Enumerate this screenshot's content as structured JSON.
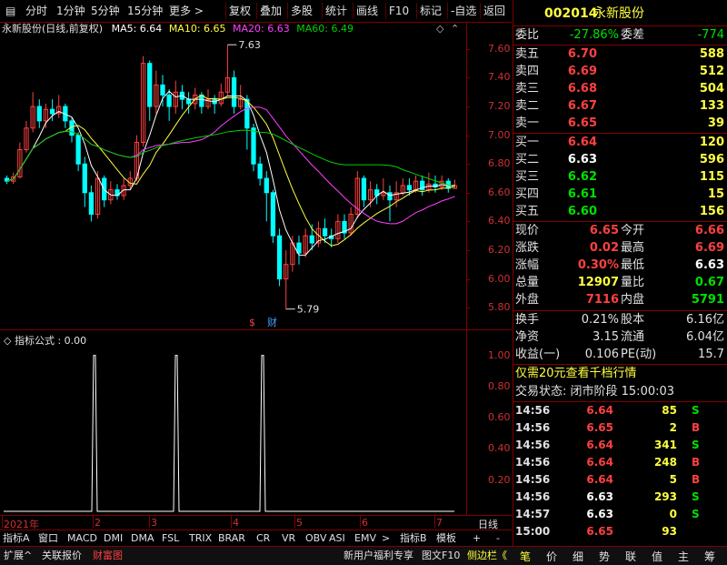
{
  "colors": {
    "up": "#ff4040",
    "down": "#00e000",
    "flat": "#ffffff",
    "ma5": "#ffffff",
    "ma10": "#ffff40",
    "ma20": "#ff40ff",
    "ma60": "#00d000",
    "grid": "#800000",
    "axis": "#d03030"
  },
  "toolbar": {
    "left": [
      "分时",
      "1分钟",
      "5分钟",
      "15分钟",
      "更多 >"
    ],
    "right": [
      "复权",
      "叠加",
      "多股",
      "统计",
      "画线",
      "F10",
      "标记",
      "-自选",
      "返回"
    ]
  },
  "chart": {
    "stock_name": "永新股份(日线,前复权)",
    "ma5_label": "MA5: 6.64",
    "ma10_label": "MA10: 6.65",
    "ma20_label": "MA20: 6.63",
    "ma60_label": "MA60: 6.49",
    "y_ticks": [
      "7.60",
      "7.40",
      "7.20",
      "7.00",
      "6.80",
      "6.60",
      "6.40",
      "6.20",
      "6.00",
      "5.80"
    ],
    "high_mark": "7.63",
    "low_mark": "5.79",
    "event_marks": [
      "$",
      "财"
    ]
  },
  "indicator": {
    "title": "指标公式 : 0.00",
    "y_ticks": [
      "1.00",
      "0.80",
      "0.60",
      "0.40",
      "0.20"
    ]
  },
  "x_axis": {
    "labels": [
      "2021年",
      "2",
      "3",
      "4",
      "5",
      "6",
      "7"
    ],
    "right_label": "日线"
  },
  "chart_data": {
    "type": "candlestick",
    "y_range": [
      5.75,
      7.65
    ],
    "candles": [
      [
        6.7,
        6.68,
        6.72,
        6.66
      ],
      [
        6.68,
        6.71,
        6.74,
        6.66
      ],
      [
        6.71,
        6.9,
        6.95,
        6.7
      ],
      [
        6.9,
        7.05,
        7.1,
        6.88
      ],
      [
        7.05,
        7.2,
        7.3,
        7.02
      ],
      [
        7.2,
        7.1,
        7.25,
        7.05
      ],
      [
        7.1,
        7.18,
        7.22,
        7.05
      ],
      [
        7.18,
        7.15,
        7.25,
        7.1
      ],
      [
        7.15,
        7.2,
        7.28,
        7.12
      ],
      [
        7.2,
        7.1,
        7.22,
        7.05
      ],
      [
        7.1,
        7.0,
        7.12,
        6.95
      ],
      [
        7.0,
        6.8,
        7.02,
        6.75
      ],
      [
        6.8,
        6.6,
        6.85,
        6.5
      ],
      [
        6.6,
        6.45,
        6.65,
        6.4
      ],
      [
        6.45,
        6.7,
        6.75,
        6.42
      ],
      [
        6.7,
        6.55,
        6.72,
        6.5
      ],
      [
        6.55,
        6.62,
        6.68,
        6.52
      ],
      [
        6.62,
        6.58,
        6.66,
        6.55
      ],
      [
        6.58,
        6.65,
        6.7,
        6.55
      ],
      [
        6.65,
        6.7,
        6.75,
        6.62
      ],
      [
        6.7,
        6.95,
        7.0,
        6.68
      ],
      [
        6.95,
        7.5,
        7.55,
        6.92
      ],
      [
        7.5,
        7.2,
        7.52,
        7.1
      ],
      [
        7.2,
        7.35,
        7.45,
        7.15
      ],
      [
        7.35,
        7.28,
        7.42,
        7.2
      ],
      [
        7.28,
        7.2,
        7.32,
        7.1
      ],
      [
        7.2,
        7.3,
        7.38,
        7.15
      ],
      [
        7.3,
        7.25,
        7.35,
        7.18
      ],
      [
        7.25,
        7.22,
        7.3,
        7.15
      ],
      [
        7.22,
        7.28,
        7.33,
        7.18
      ],
      [
        7.28,
        7.2,
        7.3,
        7.15
      ],
      [
        7.2,
        7.25,
        7.32,
        7.18
      ],
      [
        7.25,
        7.22,
        7.28,
        7.15
      ],
      [
        7.22,
        7.3,
        7.36,
        7.2
      ],
      [
        7.3,
        7.4,
        7.63,
        7.28
      ],
      [
        7.4,
        7.2,
        7.45,
        7.15
      ],
      [
        7.2,
        7.25,
        7.35,
        7.18
      ],
      [
        7.25,
        7.05,
        7.28,
        6.9
      ],
      [
        7.05,
        6.8,
        7.08,
        6.75
      ],
      [
        6.8,
        6.7,
        6.85,
        6.65
      ],
      [
        6.7,
        6.6,
        6.75,
        6.4
      ],
      [
        6.6,
        6.3,
        6.62,
        6.25
      ],
      [
        6.3,
        6.0,
        6.35,
        5.95
      ],
      [
        6.0,
        6.1,
        6.2,
        5.79
      ],
      [
        6.1,
        6.25,
        6.3,
        6.05
      ],
      [
        6.25,
        6.18,
        6.3,
        6.1
      ],
      [
        6.18,
        6.3,
        6.35,
        6.15
      ],
      [
        6.3,
        6.25,
        6.38,
        6.2
      ],
      [
        6.25,
        6.35,
        6.4,
        6.22
      ],
      [
        6.35,
        6.3,
        6.42,
        6.25
      ],
      [
        6.3,
        6.28,
        6.35,
        6.22
      ],
      [
        6.28,
        6.4,
        6.45,
        6.25
      ],
      [
        6.4,
        6.32,
        6.45,
        6.28
      ],
      [
        6.32,
        6.45,
        6.5,
        6.3
      ],
      [
        6.45,
        6.7,
        6.75,
        6.42
      ],
      [
        6.7,
        6.55,
        6.72,
        6.5
      ],
      [
        6.55,
        6.62,
        6.68,
        6.5
      ],
      [
        6.62,
        6.58,
        6.66,
        6.52
      ],
      [
        6.58,
        6.6,
        6.7,
        6.55
      ],
      [
        6.6,
        6.55,
        6.65,
        6.4
      ],
      [
        6.55,
        6.6,
        6.68,
        6.5
      ],
      [
        6.6,
        6.65,
        6.7,
        6.58
      ],
      [
        6.65,
        6.62,
        6.7,
        6.58
      ],
      [
        6.62,
        6.68,
        6.72,
        6.6
      ],
      [
        6.68,
        6.62,
        6.72,
        6.58
      ],
      [
        6.62,
        6.66,
        6.74,
        6.6
      ],
      [
        6.66,
        6.64,
        6.72,
        6.6
      ],
      [
        6.64,
        6.68,
        6.72,
        6.62
      ],
      [
        6.68,
        6.63,
        6.7,
        6.6
      ],
      [
        6.63,
        6.65,
        6.69,
        6.63
      ]
    ],
    "signal_peaks": [
      0.2,
      0.38,
      0.57
    ],
    "signal_range": [
      0,
      1.05
    ]
  },
  "quote": {
    "code": "002014",
    "name": "永新股份",
    "weibi_label": "委比",
    "weibi": "-27.86%",
    "weicha_label": "委差",
    "weicha": "-774",
    "asks": [
      {
        "label": "卖五",
        "price": "6.70",
        "vol": "588"
      },
      {
        "label": "卖四",
        "price": "6.69",
        "vol": "512"
      },
      {
        "label": "卖三",
        "price": "6.68",
        "vol": "504"
      },
      {
        "label": "卖二",
        "price": "6.67",
        "vol": "133"
      },
      {
        "label": "卖一",
        "price": "6.65",
        "vol": "39"
      }
    ],
    "bids": [
      {
        "label": "买一",
        "price": "6.64",
        "vol": "120",
        "c": "red"
      },
      {
        "label": "买二",
        "price": "6.63",
        "vol": "596",
        "c": "white"
      },
      {
        "label": "买三",
        "price": "6.62",
        "vol": "115",
        "c": "green"
      },
      {
        "label": "买四",
        "price": "6.61",
        "vol": "15",
        "c": "green"
      },
      {
        "label": "买五",
        "price": "6.60",
        "vol": "156",
        "c": "green"
      }
    ],
    "stats": [
      {
        "l1": "现价",
        "v1": "6.65",
        "c1": "red",
        "l2": "今开",
        "v2": "6.66",
        "c2": "red"
      },
      {
        "l1": "涨跌",
        "v1": "0.02",
        "c1": "red",
        "l2": "最高",
        "v2": "6.69",
        "c2": "red"
      },
      {
        "l1": "涨幅",
        "v1": "0.30%",
        "c1": "red",
        "l2": "最低",
        "v2": "6.63",
        "c2": "white"
      },
      {
        "l1": "总量",
        "v1": "12907",
        "c1": "yellow",
        "l2": "量比",
        "v2": "0.67",
        "c2": "green"
      },
      {
        "l1": "外盘",
        "v1": "7116",
        "c1": "red",
        "l2": "内盘",
        "v2": "5791",
        "c2": "green"
      }
    ],
    "stats2": [
      {
        "l1": "换手",
        "v1": "0.21%",
        "l2": "股本",
        "v2": "6.16亿"
      },
      {
        "l1": "净资",
        "v1": "3.15",
        "l2": "流通",
        "v2": "6.04亿"
      },
      {
        "l1": "收益(一)",
        "v1": "0.106",
        "l2": "PE(动)",
        "v2": "15.7"
      }
    ],
    "promo": "仅需20元查看千档行情",
    "status": "交易状态: 闭市阶段 15:00:03"
  },
  "ticks": [
    {
      "t": "14:56",
      "p": "6.64",
      "pc": "red",
      "v": "85",
      "d": "S",
      "dc": "green"
    },
    {
      "t": "14:56",
      "p": "6.65",
      "pc": "red",
      "v": "2",
      "d": "B",
      "dc": "red"
    },
    {
      "t": "14:56",
      "p": "6.64",
      "pc": "red",
      "v": "341",
      "d": "S",
      "dc": "green"
    },
    {
      "t": "14:56",
      "p": "6.64",
      "pc": "red",
      "v": "248",
      "d": "B",
      "dc": "red"
    },
    {
      "t": "14:56",
      "p": "6.64",
      "pc": "red",
      "v": "5",
      "d": "B",
      "dc": "red"
    },
    {
      "t": "14:56",
      "p": "6.63",
      "pc": "white",
      "v": "293",
      "d": "S",
      "dc": "green"
    },
    {
      "t": "14:57",
      "p": "6.63",
      "pc": "white",
      "v": "0",
      "d": "S",
      "dc": "green"
    },
    {
      "t": "15:00",
      "p": "6.65",
      "pc": "red",
      "v": "93",
      "d": "",
      "dc": "green"
    }
  ],
  "indicator_tabs": [
    "指标A",
    "窗口",
    "MACD",
    "DMI",
    "DMA",
    "FSL",
    "TRIX",
    "BRAR",
    "CR",
    "VR",
    "OBV",
    "ASI",
    "EMV",
    ">",
    "指标B",
    "模板",
    "+",
    "-"
  ],
  "bottom_left": [
    "扩展^",
    "关联报价",
    "财富图"
  ],
  "bottom_mid": [
    "新用户福利专享",
    "图文F10",
    "侧边栏《"
  ],
  "right_tabs": [
    "笔",
    "价",
    "细",
    "势",
    "联",
    "值",
    "主",
    "筹"
  ]
}
